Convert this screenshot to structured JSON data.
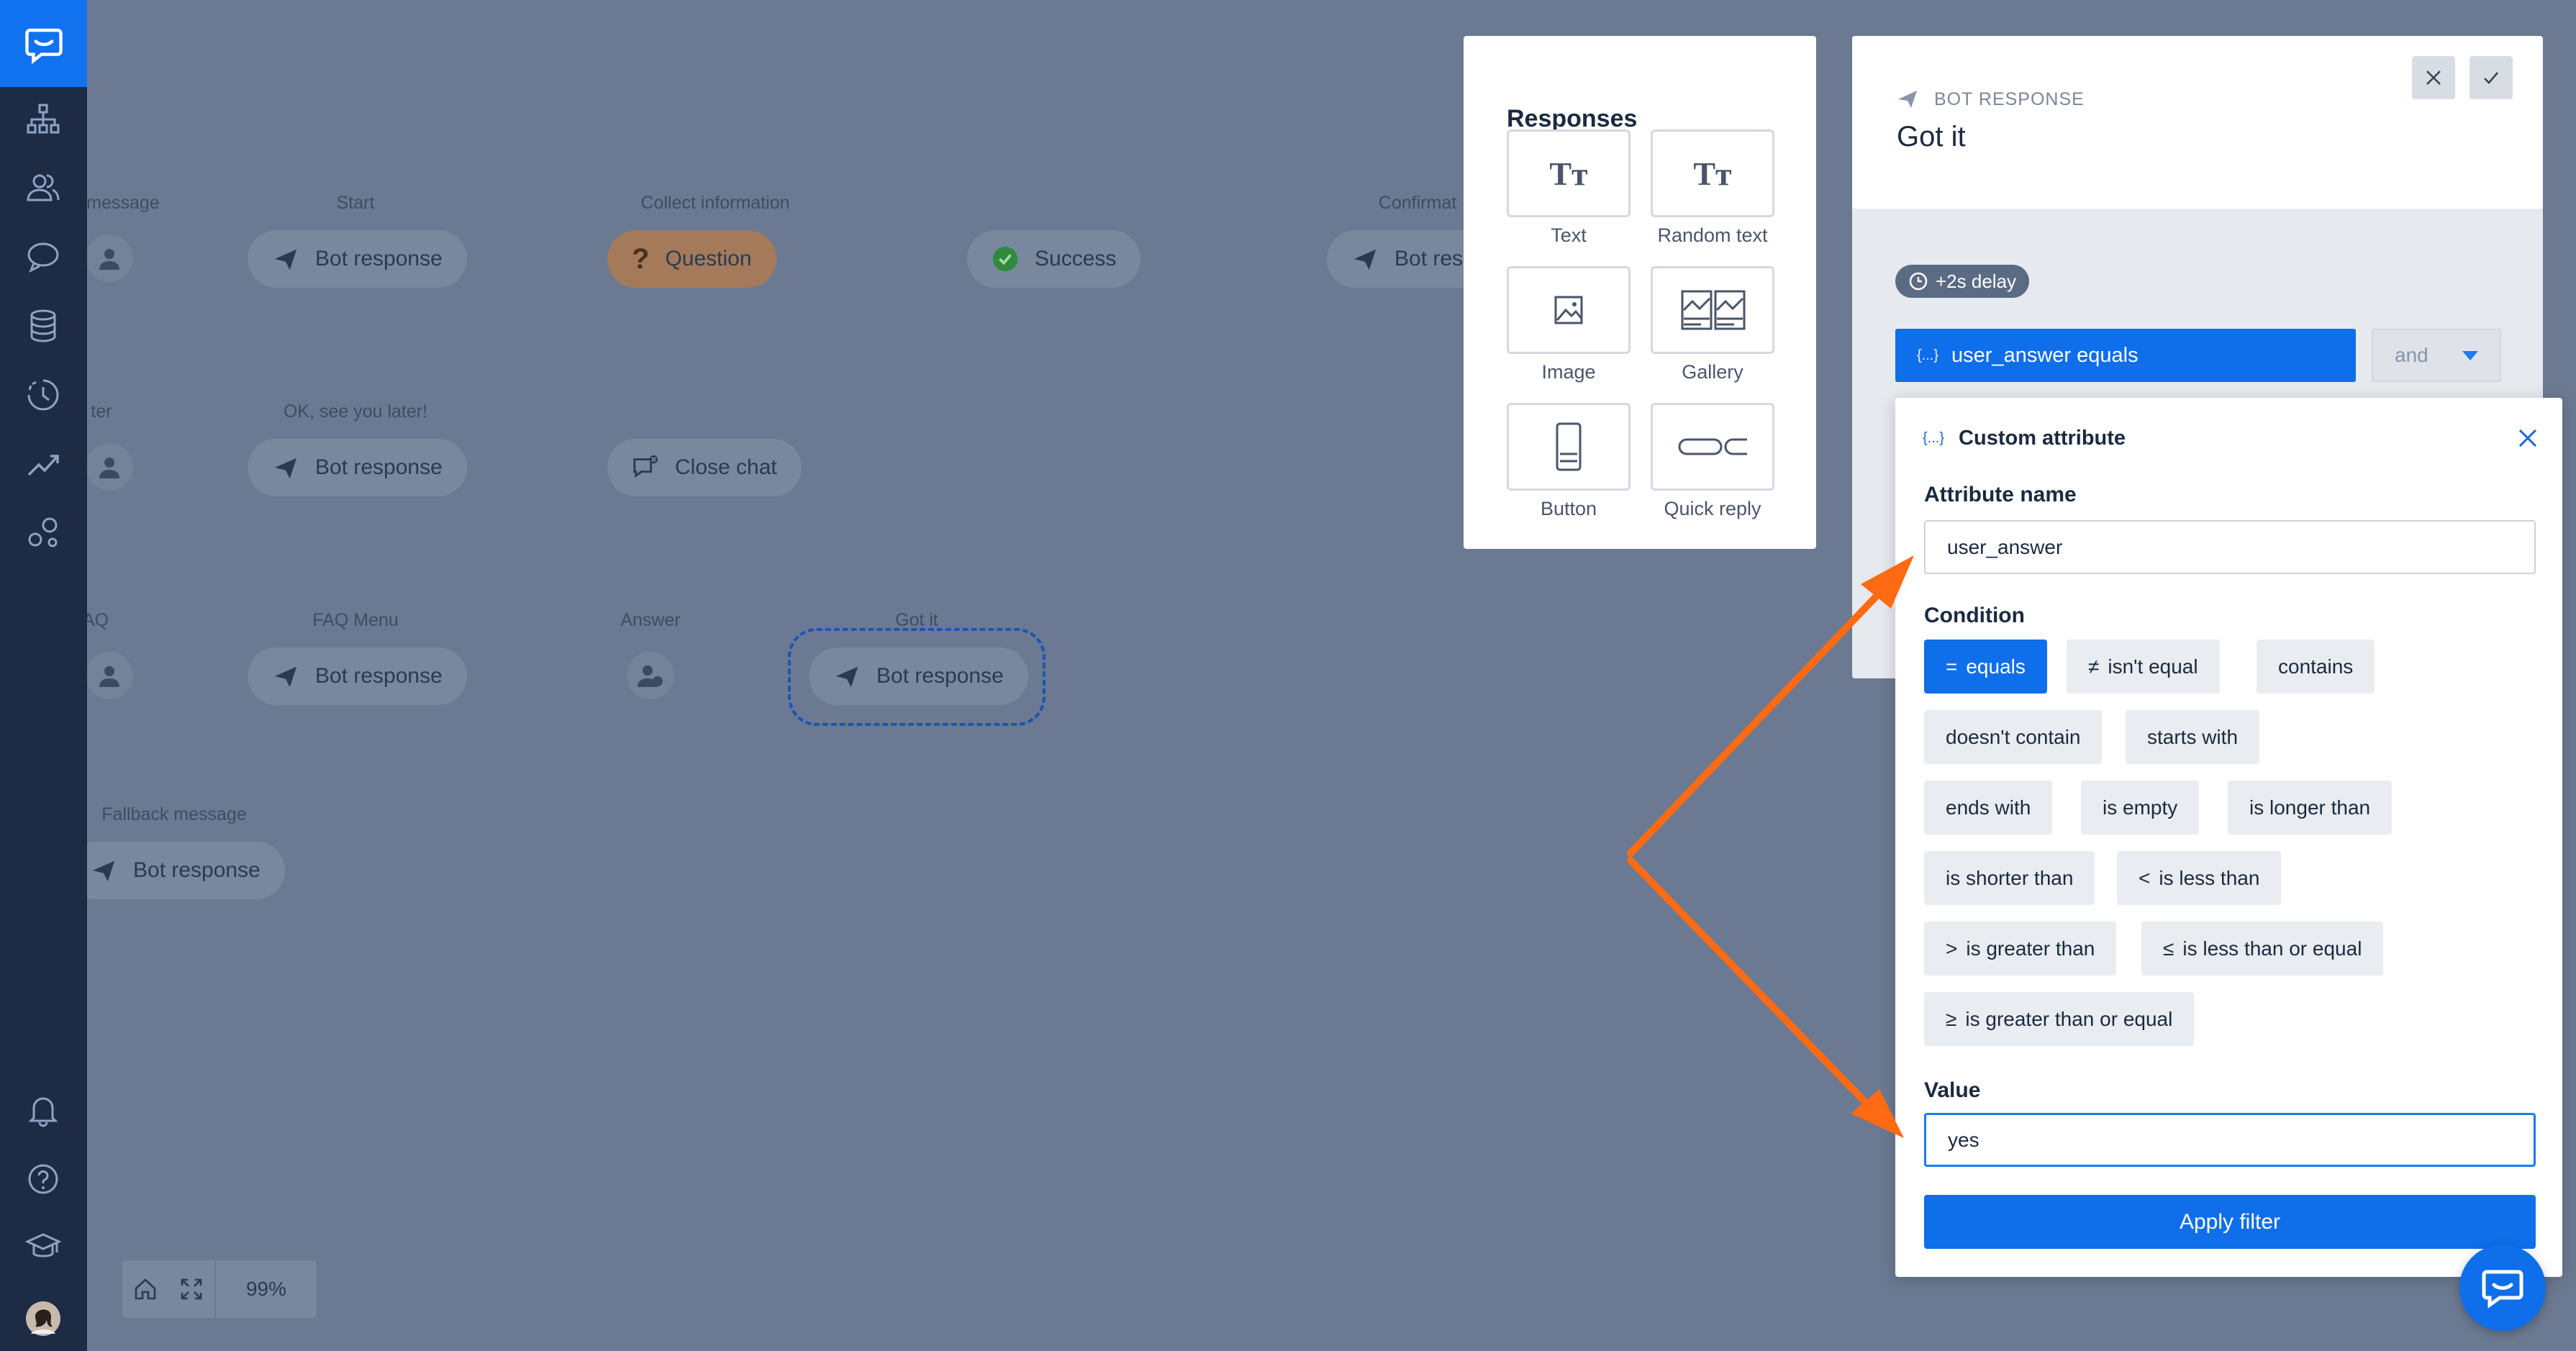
{
  "sidebar": {
    "items": [
      {
        "name": "logo-icon"
      },
      {
        "name": "flows-icon"
      },
      {
        "name": "users-icon"
      },
      {
        "name": "chat-icon"
      },
      {
        "name": "database-icon"
      },
      {
        "name": "history-icon"
      },
      {
        "name": "analytics-icon"
      },
      {
        "name": "integrations-icon"
      },
      {
        "name": "bell-icon"
      },
      {
        "name": "help-icon"
      },
      {
        "name": "academy-icon"
      },
      {
        "name": "avatar"
      }
    ]
  },
  "canvas": {
    "labels": {
      "welcome": "message",
      "start": "Start",
      "collect": "Collect information",
      "confirm": "Confirmat",
      "later": "ter",
      "see_you": "OK, see you later!",
      "faq": "AQ",
      "faq_menu": "FAQ Menu",
      "answer": "Answer",
      "got_it": "Got it",
      "fallback": "Fallback message"
    },
    "pills": {
      "start": "Bot response",
      "question": "Question",
      "success": "Success",
      "confirm": "Bot resp",
      "see_you": "Bot response",
      "close_chat": "Close chat",
      "faq_menu": "Bot response",
      "got_it": "Bot response",
      "fallback": "Bot response"
    },
    "zoom": "99%"
  },
  "responses": {
    "title": "Responses",
    "items": [
      "Text",
      "Random text",
      "Image",
      "Gallery",
      "Button",
      "Quick reply"
    ]
  },
  "bot_panel": {
    "kicker": "BOT RESPONSE",
    "title": "Got it",
    "delay": "+2s delay",
    "filter_attr": "user_answer",
    "filter_op": "equals",
    "and_label": "and"
  },
  "popover": {
    "title": "Custom attribute",
    "icon_glyph": "{...}",
    "attribute_label": "Attribute name",
    "attribute_value": "user_answer",
    "condition_label": "Condition",
    "conditions": [
      {
        "sym": "=",
        "label": "equals"
      },
      {
        "sym": "≠",
        "label": "isn't equal"
      },
      {
        "sym": "",
        "label": "contains"
      },
      {
        "sym": "",
        "label": "doesn't contain"
      },
      {
        "sym": "",
        "label": "starts with"
      },
      {
        "sym": "",
        "label": "ends with"
      },
      {
        "sym": "",
        "label": "is empty"
      },
      {
        "sym": "",
        "label": "is longer than"
      },
      {
        "sym": "",
        "label": "is shorter than"
      },
      {
        "sym": "<",
        "label": "is less than"
      },
      {
        "sym": ">",
        "label": "is greater than"
      },
      {
        "sym": "≤",
        "label": "is less than or equal"
      },
      {
        "sym": "≥",
        "label": "is greater than or equal"
      }
    ],
    "value_label": "Value",
    "value": "yes",
    "apply_label": "Apply filter"
  },
  "colors": {
    "accent": "#0f6eea",
    "overlay": "#6b7a92",
    "sidebar": "#1d2b44",
    "arrow": "#ff6a13"
  }
}
